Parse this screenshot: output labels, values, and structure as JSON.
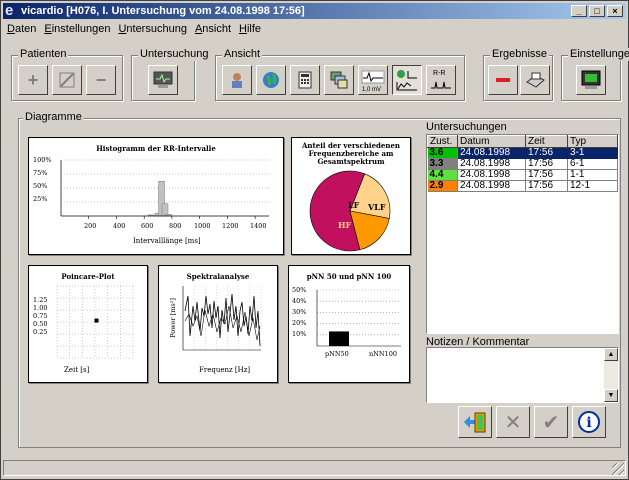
{
  "window": {
    "title": "vicardio [H076, I. Untersuchung vom 24.08.1998 17:56]",
    "icon": "vicardio-e-icon",
    "controls": [
      "_",
      "□",
      "×"
    ]
  },
  "menu": [
    {
      "label": "Daten",
      "ul": "D",
      "rest": "aten"
    },
    {
      "label": "Einstellungen",
      "ul": "E",
      "rest": "instellungen"
    },
    {
      "label": "Untersuchung",
      "ul": "U",
      "rest": "ntersuchung"
    },
    {
      "label": "Ansicht",
      "ul": "A",
      "rest": "nsicht"
    },
    {
      "label": "Hilfe",
      "ul": "H",
      "rest": "ilfe"
    }
  ],
  "toolbar": {
    "patienten": "Patienten",
    "untersuchung": "Untersuchung",
    "ansicht": "Ansicht",
    "ergebnisse": "Ergebnisse",
    "einstellungen": "Einstellungen",
    "scale_label": "1,0 mV",
    "rr_label": "R-R"
  },
  "diagramme": {
    "label": "Diagramme",
    "histogram": {
      "title": "Histogramm der RR-Intervalle",
      "xlabel": "Intervalllänge [ms]",
      "yticks": [
        "100%",
        "75%",
        "50%",
        "25%"
      ],
      "xticks": [
        "200",
        "400",
        "600",
        "800",
        "1000",
        "1200",
        "1400"
      ]
    },
    "pie": {
      "title_line1": "Anteil der verschiedenen",
      "title_line2": "Frequenzbereiche am",
      "title_line3": "Gesamtspektrum",
      "lf": "LF",
      "vlf": "VLF",
      "hf": "HF"
    },
    "poincare": {
      "title": "Poincare-Plot",
      "xlabel": "Zeit [s]",
      "yticks": [
        "1.25",
        "1.00",
        "0.75",
        "0.50",
        "0.25"
      ]
    },
    "spektral": {
      "title": "Spektralanalyse",
      "xlabel": "Frequenz [Hz]",
      "ylabel": "Power [ms²]"
    },
    "pnn": {
      "title": "pNN 50 und pNN 100",
      "yticks": [
        "50%",
        "40%",
        "30%",
        "20%",
        "10%"
      ],
      "cat1": "pNN50",
      "cat2": "nNN100"
    }
  },
  "chart_data": [
    {
      "type": "bar",
      "title": "Histogramm der RR-Intervalle",
      "xlabel": "Intervalllänge [ms]",
      "x": [
        650,
        700,
        725,
        750,
        775
      ],
      "values": [
        2,
        5,
        62,
        22,
        3
      ],
      "xlim": [
        0,
        1500
      ],
      "ylim": [
        0,
        100
      ]
    },
    {
      "type": "pie",
      "title": "Anteil der verschiedenen Frequenzbereiche am Gesamtspektrum",
      "categories": [
        "HF",
        "LF",
        "VLF"
      ],
      "values": [
        60,
        22,
        18
      ],
      "colors": [
        "#c0105e",
        "#ffd48a",
        "#ff9900"
      ]
    },
    {
      "type": "scatter",
      "title": "Poincare-Plot",
      "xlabel": "Zeit [s]",
      "x": [
        0.78
      ],
      "y": [
        0.78
      ],
      "ylim": [
        0,
        1.5
      ]
    },
    {
      "type": "bar",
      "title": "pNN 50 und pNN 100",
      "categories": [
        "pNN50",
        "nNN100"
      ],
      "values": [
        13,
        0
      ],
      "ylim": [
        0,
        50
      ]
    }
  ],
  "untersuchungen": {
    "label": "Untersuchungen",
    "headers": [
      "Zust.",
      "Datum",
      "Zeit",
      "Typ"
    ],
    "rows": [
      {
        "zust": "3.6",
        "datum": "24.08.1998",
        "zeit": "17:56",
        "typ": "3-1",
        "color": "#00c000"
      },
      {
        "zust": "3.3",
        "datum": "24.08.1998",
        "zeit": "17:56",
        "typ": "6-1",
        "color": "#808080"
      },
      {
        "zust": "4.4",
        "datum": "24.08.1998",
        "zeit": "17:56",
        "typ": "1-1",
        "color": "#60e040"
      },
      {
        "zust": "2.9",
        "datum": "24.08.1998",
        "zeit": "17:56",
        "typ": "12-1",
        "color": "#ff8000"
      }
    ]
  },
  "notizen": {
    "label": "Notizen / Kommentar",
    "value": ""
  },
  "colors": {
    "title_start": "#0a246a",
    "title_end": "#a6caf0",
    "face": "#d4d0c8"
  }
}
